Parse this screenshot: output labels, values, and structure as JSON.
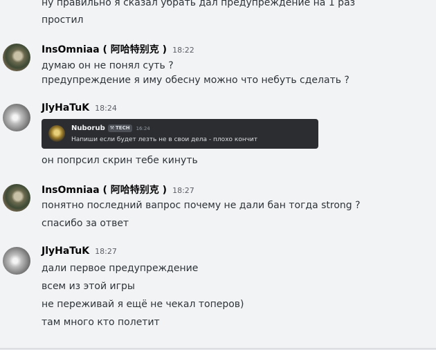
{
  "messages": {
    "m0": {
      "lines": [
        "ну правильно я сказал убрать дал предупреждение на 1 раз",
        "простил"
      ]
    },
    "m1": {
      "username": "InsOmniaa ( 阿哈特别克 )",
      "time": "18:22",
      "lines": [
        "думаю он не понял суть ?",
        "предупреждение я иму обесну можно что небуть сделать ?"
      ]
    },
    "m2": {
      "username": "JlyHaTuK",
      "time": "18:24",
      "embed": {
        "name": "Nuborub",
        "tag": "TECH",
        "time": "16:24",
        "text": "Напиши если будет лезть не в свои дела - плохо кончит"
      },
      "lines": [
        "он попрсил скрин тебе кинуть"
      ]
    },
    "m3": {
      "username": "InsOmniaa ( 阿哈特别克 )",
      "time": "18:27",
      "lines": [
        "понятно последний вапрос почему не дали бан тогда strong ?",
        "спасибо за ответ"
      ]
    },
    "m4": {
      "username": "JlyHaTuK",
      "time": "18:27",
      "lines": [
        "дали первое предупреждение",
        "всем из этой игры",
        "не переживай я ещё не чекал топеров)",
        "там много кто полетит"
      ]
    }
  }
}
